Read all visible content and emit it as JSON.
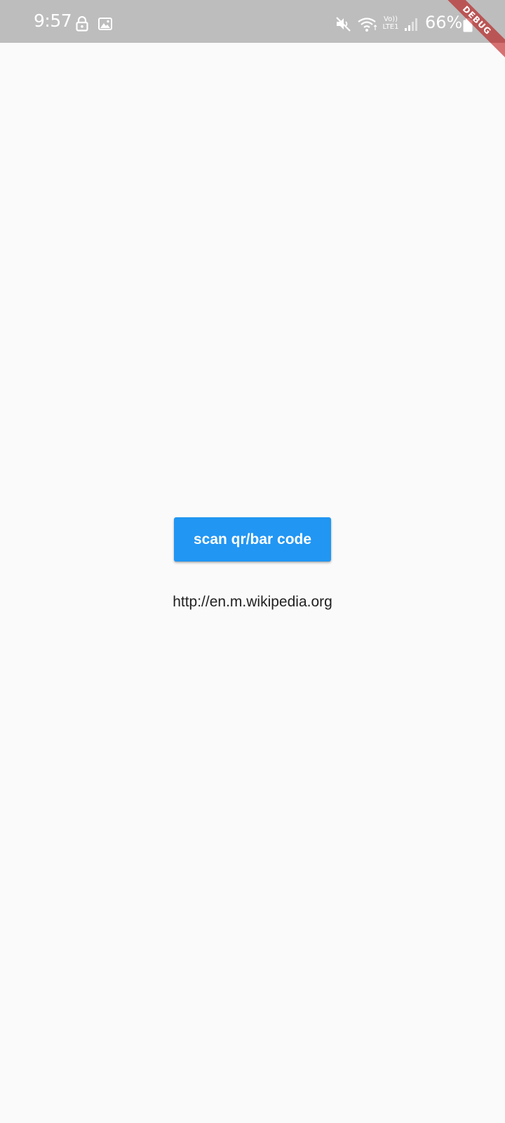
{
  "status_bar": {
    "time": "9:57",
    "network": "Vo)) LTE1",
    "battery_percent": "66%",
    "icons": [
      "lock-icon",
      "image-icon",
      "mute-icon",
      "wifi-icon",
      "signal-icon",
      "battery-icon"
    ]
  },
  "debug_banner": {
    "label": "DEBUG"
  },
  "main": {
    "scan_button_label": "scan qr/bar code",
    "scan_result": "http://en.m.wikipedia.org"
  },
  "colors": {
    "status_bar": "#bdbdbd",
    "background": "#fafafa",
    "accent": "#2196f3",
    "debug_ribbon": "#b80000"
  }
}
